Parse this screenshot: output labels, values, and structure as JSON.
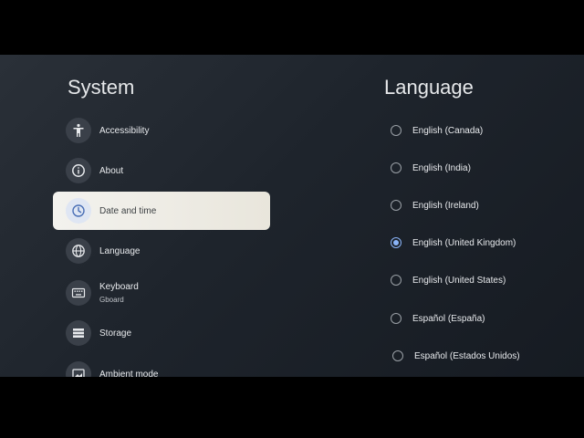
{
  "left_panel": {
    "title": "System",
    "items": [
      {
        "label": "Accessibility",
        "icon": "accessibility-icon"
      },
      {
        "label": "About",
        "icon": "info-icon"
      },
      {
        "label": "Date and time",
        "icon": "clock-icon",
        "selected": true
      },
      {
        "label": "Language",
        "icon": "globe-icon"
      },
      {
        "label": "Keyboard",
        "sub": "Gboard",
        "icon": "keyboard-icon"
      },
      {
        "label": "Storage",
        "icon": "storage-icon"
      },
      {
        "label": "Ambient mode",
        "icon": "ambient-mode-icon"
      }
    ]
  },
  "right_panel": {
    "title": "Language",
    "options": [
      {
        "label": "English (Canada)",
        "checked": false
      },
      {
        "label": "English (India)",
        "checked": false
      },
      {
        "label": "English (Ireland)",
        "checked": false
      },
      {
        "label": "English (United Kingdom)",
        "checked": true
      },
      {
        "label": "English (United States)",
        "checked": false
      },
      {
        "label": "Español (España)",
        "checked": false
      },
      {
        "label": "Español (Estados Unidos)",
        "checked": false
      }
    ]
  },
  "colors": {
    "accent": "#8ab4f8",
    "selected_bg": "#f3f2ee"
  }
}
